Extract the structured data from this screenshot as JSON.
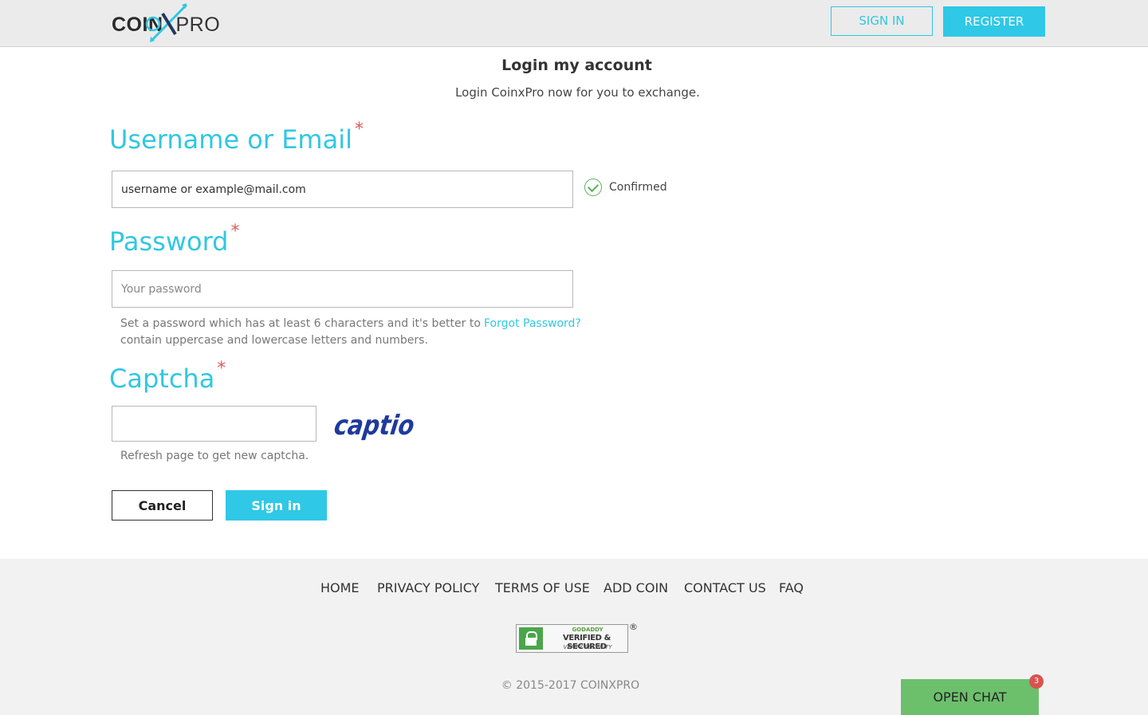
{
  "header": {
    "logo": {
      "coin": "COIN",
      "x": "X",
      "pro": "PRO"
    },
    "signin_label": "SIGN IN",
    "register_label": "REGISTER"
  },
  "main": {
    "title": "Login my account",
    "subtitle": "Login CoinxPro now for you to exchange.",
    "username": {
      "label": "Username or Email",
      "required_mark": "*",
      "value": "username or example@mail.com",
      "status_icon": "check-circle-icon",
      "status_text": "Confirmed"
    },
    "password": {
      "label": "Password",
      "required_mark": "*",
      "placeholder": "Your password",
      "hint_line1": "Set a password which has at least 6 characters and it's better to",
      "hint_line2": "contain uppercase and lowercase letters and numbers.",
      "forgot_label": "Forgot Password?"
    },
    "captcha": {
      "label": "Captcha",
      "required_mark": "*",
      "value": "",
      "image_text": "captio",
      "hint": "Refresh page to get new captcha."
    },
    "cancel_label": "Cancel",
    "signin_label": "Sign in"
  },
  "footer": {
    "nav": [
      "HOME",
      "PRIVACY POLICY",
      "TERMS OF USE",
      "ADD COIN",
      "CONTACT US",
      "FAQ"
    ],
    "seal": {
      "line1": "GODADDY",
      "line2": "VERIFIED & SECURED",
      "line3": "VERIFY SECURITY",
      "reg": "®"
    },
    "copyright": "© 2015-2017 COINXPRO"
  },
  "chat": {
    "label": "OPEN CHAT",
    "badge": "3"
  },
  "colors": {
    "accent": "#2fc8e6",
    "required": "#e05a5a",
    "success": "#5ab35a",
    "chat": "#6cc06c",
    "badge": "#d9534f"
  }
}
